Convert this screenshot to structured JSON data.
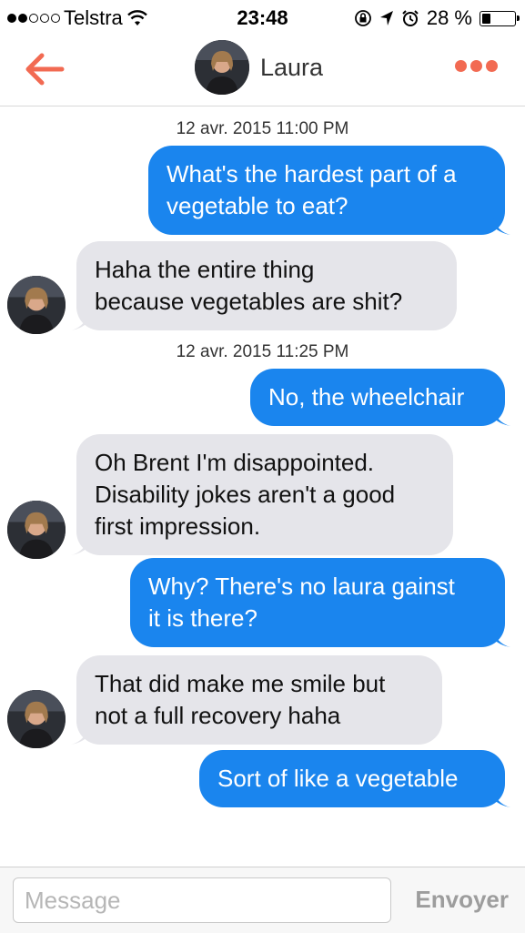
{
  "status_bar": {
    "carrier": "Telstra",
    "time": "23:48",
    "battery_percent": "28 %",
    "battery_level": 0.28,
    "signal_bars_filled": 2,
    "signal_bars_total": 5
  },
  "header": {
    "contact_name": "Laura",
    "accent_color": "#f26a52"
  },
  "messages": [
    {
      "type": "timestamp",
      "text": "12 avr. 2015 11:00 PM"
    },
    {
      "type": "outgoing",
      "lines": [
        "What's the hardest part of a",
        "vegetable to eat?"
      ]
    },
    {
      "type": "incoming",
      "lines": [
        "Haha the entire thing",
        "because vegetables are shit?"
      ]
    },
    {
      "type": "timestamp",
      "text": "12 avr. 2015 11:25 PM"
    },
    {
      "type": "outgoing",
      "lines": [
        "No, the wheelchair"
      ]
    },
    {
      "type": "incoming",
      "lines": [
        "Oh Brent I'm disappointed.",
        "Disability jokes aren't a good",
        "first impression."
      ]
    },
    {
      "type": "outgoing",
      "lines": [
        "Why? There's no laura gainst",
        "it is there?"
      ]
    },
    {
      "type": "incoming",
      "lines": [
        "That did make me smile but",
        "not a full recovery haha"
      ]
    },
    {
      "type": "outgoing",
      "lines": [
        "Sort of like a vegetable"
      ]
    }
  ],
  "input": {
    "placeholder": "Message",
    "value": "",
    "send_label": "Envoyer"
  },
  "colors": {
    "outgoing_bubble": "#1a85ee",
    "incoming_bubble": "#e5e5ea"
  }
}
